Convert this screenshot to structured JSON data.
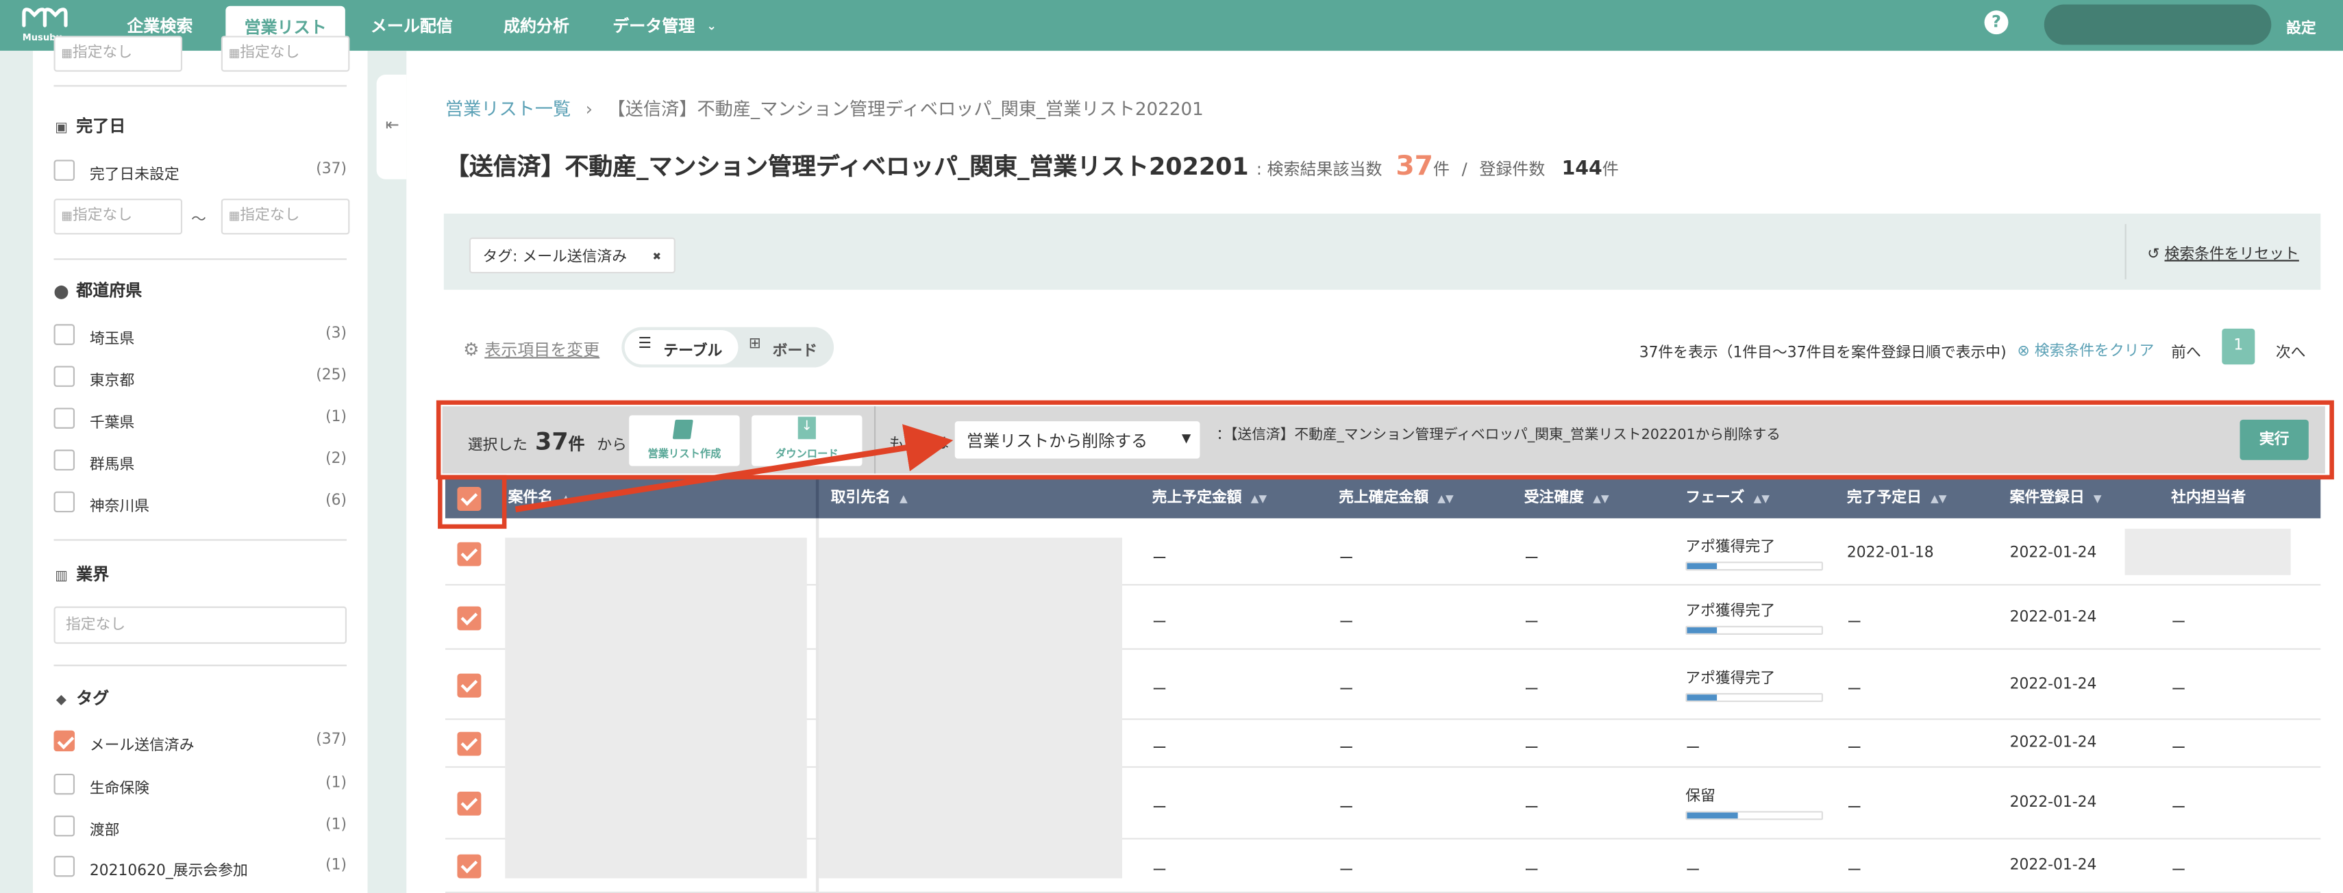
{
  "nav": {
    "logo_text": "Musubu",
    "items": [
      "企業検索",
      "営業リスト",
      "メール配信",
      "成約分析",
      "データ管理"
    ],
    "active_index": 1,
    "data_mgmt_chevron": "chevron-down-icon",
    "help_icon": "question-circle-icon",
    "settings_label": "設定"
  },
  "sidebar": {
    "top_inputs": [
      "指定なし",
      "指定なし"
    ],
    "completion": {
      "title": "完了日",
      "icon": "calendar-icon",
      "unset_label": "完了日未設定",
      "unset_count": "(37)",
      "from_placeholder": "指定なし",
      "to_placeholder": "指定なし",
      "range_sep": "〜"
    },
    "prefecture": {
      "title": "都道府県",
      "icon": "map-pin-icon",
      "items": [
        {
          "label": "埼玉県",
          "count": "(3)"
        },
        {
          "label": "東京都",
          "count": "(25)"
        },
        {
          "label": "千葉県",
          "count": "(1)"
        },
        {
          "label": "群馬県",
          "count": "(2)"
        },
        {
          "label": "神奈川県",
          "count": "(6)"
        }
      ]
    },
    "industry": {
      "title": "業界",
      "icon": "building-icon",
      "placeholder": "指定なし"
    },
    "tags": {
      "title": "タグ",
      "icon": "tag-icon",
      "items": [
        {
          "label": "メール送信済み",
          "count": "(37)",
          "checked": true
        },
        {
          "label": "生命保険",
          "count": "(1)",
          "checked": false
        },
        {
          "label": "渡部",
          "count": "(1)",
          "checked": false
        },
        {
          "label": "20210620_展示会参加",
          "count": "(1)",
          "checked": false
        }
      ]
    }
  },
  "main": {
    "breadcrumb_link": "営業リスト一覧",
    "breadcrumb_sep": "›",
    "breadcrumb_current": "【送信済】不動産_マンション管理ディベロッパ_関東_営業リスト202201",
    "title": "【送信済】不動産_マンション管理ディベロッパ_関東_営業リスト202201",
    "result_label": ": 検索結果該当数",
    "result_count": "37",
    "result_unit": "件",
    "result_slash": "/",
    "registered_label": "登録件数",
    "registered_count": "144",
    "registered_unit": "件",
    "filter_tag": "タグ: メール送信済み",
    "filter_tag_remove": "✖",
    "reset_label": "検索条件をリセット",
    "display_change": "表示項目を変更",
    "view_table": "テーブル",
    "view_board": "ボード",
    "paging_text": "37件を表示（1件目〜37件目を案件登録日順で表示中)",
    "clear_conditions": "検索条件をクリア",
    "prev": "前へ",
    "page": "1",
    "next": "次へ",
    "action_bar": {
      "selected_prefix": "選択した",
      "selected_count": "37",
      "selected_unit": "件",
      "selected_suffix": "から",
      "create_list": "営業リスト作成",
      "download": "ダウンロード",
      "or_label": "もしくは",
      "select_value": "営業リストから削除する",
      "action_desc": "：【送信済】不動産_マンション管理ディベロッパ_関東_営業リスト202201から削除する",
      "execute": "実行"
    },
    "table": {
      "columns": [
        "案件名",
        "取引先名",
        "売上予定金額",
        "売上確定金額",
        "受注確度",
        "フェーズ",
        "完了予定日",
        "案件登録日",
        "社内担当者"
      ],
      "rows": [
        {
          "sales_plan": "ー",
          "sales_fixed": "ー",
          "probability": "ー",
          "phase": "アポ獲得完了",
          "progress": 0.22,
          "due": "2022-01-18",
          "registered": "2022-01-24",
          "owner": ""
        },
        {
          "sales_plan": "ー",
          "sales_fixed": "ー",
          "probability": "ー",
          "phase": "アポ獲得完了",
          "progress": 0.22,
          "due": "ー",
          "registered": "2022-01-24",
          "owner": "ー"
        },
        {
          "sales_plan": "ー",
          "sales_fixed": "ー",
          "probability": "ー",
          "phase": "アポ獲得完了",
          "progress": 0.22,
          "due": "ー",
          "registered": "2022-01-24",
          "owner": "ー"
        },
        {
          "sales_plan": "ー",
          "sales_fixed": "ー",
          "probability": "ー",
          "phase": "ー",
          "progress": null,
          "due": "ー",
          "registered": "2022-01-24",
          "owner": "ー"
        },
        {
          "sales_plan": "ー",
          "sales_fixed": "ー",
          "probability": "ー",
          "phase": "保留",
          "progress": 0.38,
          "due": "ー",
          "registered": "2022-01-24",
          "owner": "ー"
        },
        {
          "sales_plan": "ー",
          "sales_fixed": "ー",
          "probability": "ー",
          "phase": "ー",
          "progress": null,
          "due": "ー",
          "registered": "2022-01-24",
          "owner": "ー"
        }
      ]
    }
  },
  "colors": {
    "brand": "#5aa898",
    "accent": "#ef8a6c",
    "table_header": "#5b6b84",
    "annotation": "#e04226",
    "progress": "#4d8fc7"
  }
}
